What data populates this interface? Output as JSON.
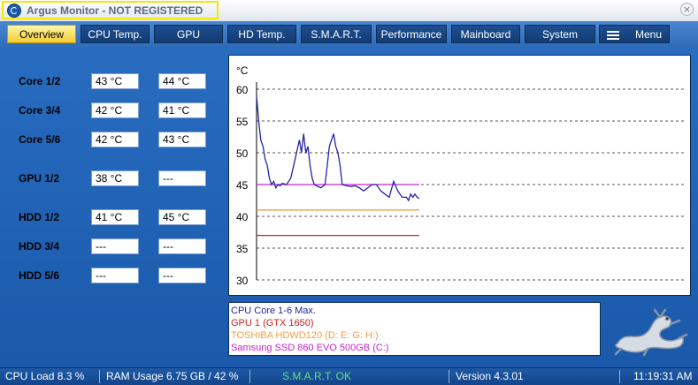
{
  "window": {
    "title": "Argus Monitor - NOT REGISTERED",
    "close_glyph": "×",
    "title_highlight_color": "#f4e800"
  },
  "tabs": [
    {
      "label": "Overview",
      "active": true
    },
    {
      "label": "CPU Temp."
    },
    {
      "label": "GPU"
    },
    {
      "label": "HD Temp."
    },
    {
      "label": "S.M.A.R.T."
    },
    {
      "label": "Performance"
    },
    {
      "label": "Mainboard"
    },
    {
      "label": "System"
    },
    {
      "label": "Menu",
      "icon": "hamburger-icon"
    }
  ],
  "sensors": [
    {
      "label": "Core 1/2",
      "v1": "43 °C",
      "v2": "44 °C"
    },
    {
      "label": "Core 3/4",
      "v1": "42 °C",
      "v2": "41 °C"
    },
    {
      "label": "Core 5/6",
      "v1": "42 °C",
      "v2": "43 °C"
    },
    {
      "label": "GPU 1/2",
      "v1": "38 °C",
      "v2": "---"
    },
    {
      "label": "HDD 1/2",
      "v1": "41 °C",
      "v2": "45 °C"
    },
    {
      "label": "HDD 3/4",
      "v1": "---",
      "v2": "---"
    },
    {
      "label": "HDD 5/6",
      "v1": "---",
      "v2": "---"
    }
  ],
  "chart_data": {
    "type": "line",
    "unit_label": "°C",
    "ylim": [
      30,
      60
    ],
    "yticks": [
      60,
      55,
      50,
      45,
      40,
      35,
      30
    ],
    "xlim": [
      0,
      100
    ],
    "grid": true,
    "series": [
      {
        "name": "CPU Core 1-6 Max.",
        "color": "#2424a6",
        "x": [
          0,
          0.5,
          1,
          1.5,
          2,
          2.5,
          3,
          3.5,
          4,
          4.5,
          5,
          5.5,
          6,
          7,
          8,
          9,
          10,
          10.5,
          11,
          11.5,
          12,
          12.5,
          13,
          13.5,
          14,
          15,
          16,
          16.5,
          17,
          17.5,
          18,
          18.5,
          19,
          19.5,
          20,
          21,
          22,
          23,
          24,
          25,
          26,
          27,
          28,
          29,
          30,
          31,
          32,
          33,
          34,
          35,
          35.5,
          36,
          36.5,
          37,
          37.5,
          38
        ],
        "y": [
          59,
          55,
          52,
          51,
          49,
          48,
          46,
          45,
          45.5,
          44.5,
          45,
          44.8,
          45.2,
          45,
          46,
          49,
          52,
          50,
          53,
          50,
          51,
          48,
          46,
          45,
          44.8,
          44.5,
          45,
          48,
          51,
          52,
          53,
          51,
          50,
          48,
          45,
          44.8,
          44.7,
          44.8,
          44.5,
          44,
          44.5,
          45,
          45,
          44,
          43.5,
          43,
          45.5,
          44,
          43,
          43,
          42.5,
          43.5,
          43,
          43.5,
          43,
          42.8
        ]
      },
      {
        "name": "GPU 1 (GTX 1650)",
        "color": "#cc2222",
        "x": [
          0,
          38
        ],
        "y": [
          37,
          37
        ]
      },
      {
        "name": "TOSHIBA HDWD120 (D: E: G: H:)",
        "color": "#f0a040",
        "x": [
          0,
          38
        ],
        "y": [
          41,
          41
        ]
      },
      {
        "name": "Samsung SSD 860 EVO 500GB (C:)",
        "color": "#cc22cc",
        "x": [
          0,
          38
        ],
        "y": [
          45,
          45
        ]
      }
    ]
  },
  "legend": [
    {
      "name": "CPU Core 1-6 Max.",
      "color": "#2424a6"
    },
    {
      "name": "GPU 1 (GTX 1650)",
      "color": "#cc2222"
    },
    {
      "name": "TOSHIBA HDWD120 (D: E: G: H:)",
      "color": "#f0a040"
    },
    {
      "name": "Samsung SSD 860 EVO 500GB (C:)",
      "color": "#cc22cc"
    }
  ],
  "logo_icon": "gecko-logo-icon",
  "statusbar": {
    "cpu_load": "CPU Load 8.3 %",
    "ram_usage": "RAM Usage 6.75 GB / 42 %",
    "smart": "S.M.A.R.T. OK",
    "smart_color": "#5ee07a",
    "version": "Version 4.3.01",
    "time": "11:19:31 AM"
  }
}
